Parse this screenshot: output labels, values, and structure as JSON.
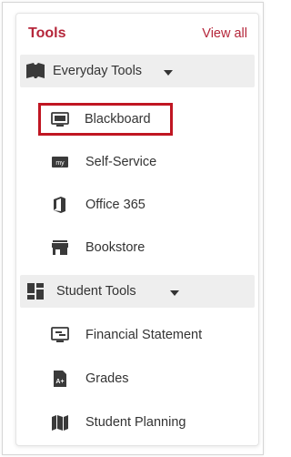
{
  "header": {
    "title": "Tools",
    "view_all": "View all"
  },
  "sections": [
    {
      "label": "Everyday Tools",
      "icon": "book-open-icon",
      "items": [
        {
          "label": "Blackboard",
          "icon": "blackboard-icon",
          "highlighted": true
        },
        {
          "label": "Self-Service",
          "icon": "my-icon",
          "icon_text": "my"
        },
        {
          "label": "Office 365",
          "icon": "office-icon"
        },
        {
          "label": "Bookstore",
          "icon": "store-icon"
        }
      ]
    },
    {
      "label": "Student Tools",
      "icon": "dashboard-icon",
      "items": [
        {
          "label": "Financial Statement",
          "icon": "financial-statement-icon"
        },
        {
          "label": "Grades",
          "icon": "grades-icon",
          "icon_text": "A+"
        },
        {
          "label": "Student Planning",
          "icon": "map-icon"
        }
      ]
    }
  ],
  "colors": {
    "accent": "#b5263a",
    "highlight_border": "#c01622",
    "section_bg": "#eeeeee",
    "icon": "#3a3a3a"
  }
}
